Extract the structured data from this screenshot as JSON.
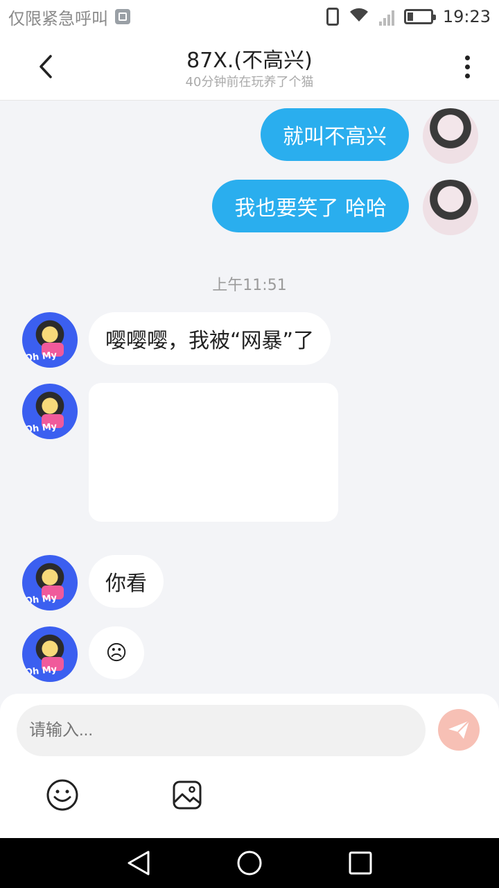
{
  "status_bar": {
    "carrier_text": "仅限紧急呼叫",
    "time": "19:23"
  },
  "header": {
    "title": "87X.(不高兴)",
    "subtitle": "40分钟前在玩养了个猫"
  },
  "messages": {
    "outgoing": [
      {
        "text": "就叫不高兴"
      },
      {
        "text": "我也要笑了 哈哈"
      }
    ],
    "timestamp": "上午11:51",
    "incoming": [
      {
        "text": "嘤嘤嘤，我被“网暴”了"
      },
      {
        "text": "你看"
      },
      {
        "text": "☹"
      }
    ],
    "avatar_text": "Oh My"
  },
  "input": {
    "placeholder": "请输入..."
  },
  "colors": {
    "outgoing_bubble": "#2aaeee",
    "send_button": "#f7c0b5",
    "background": "#f3f4f7"
  },
  "icons": {
    "back": "chevron-left-icon",
    "more": "more-vertical-icon",
    "send": "paper-plane-icon",
    "emoji": "smile-icon",
    "image": "image-icon"
  }
}
